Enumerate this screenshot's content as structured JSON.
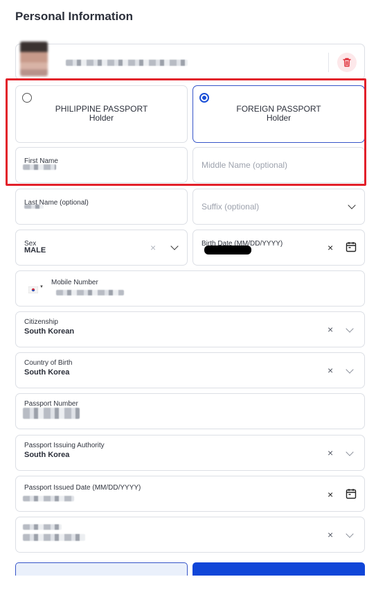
{
  "page": {
    "title": "Personal Information"
  },
  "passport_type": {
    "options": [
      {
        "line1": "PHILIPPINE PASSPORT",
        "line2": "Holder",
        "selected": false
      },
      {
        "line1": "FOREIGN PASSPORT",
        "line2": "Holder",
        "selected": true
      }
    ]
  },
  "fields": {
    "first_name": {
      "label": "First Name"
    },
    "middle_name": {
      "placeholder": "Middle Name (optional)"
    },
    "last_name": {
      "label": "Last Name (optional)"
    },
    "suffix": {
      "placeholder": "Suffix (optional)"
    },
    "sex": {
      "label": "Sex",
      "value": "MALE"
    },
    "birth_date": {
      "label": "Birth Date (MM/DD/YYYY)"
    },
    "mobile": {
      "label": "Mobile Number"
    },
    "citizenship": {
      "label": "Citizenship",
      "value": "South Korean"
    },
    "country_of_birth": {
      "label": "Country of Birth",
      "value": "South Korea"
    },
    "passport_number": {
      "label": "Passport Number"
    },
    "passport_authority": {
      "label": "Passport Issuing Authority",
      "value": "South Korea"
    },
    "passport_issued": {
      "label": "Passport Issued Date (MM/DD/YYYY)"
    }
  },
  "icons": {
    "clear": "×",
    "delete": "trash-icon",
    "calendar": "calendar-icon",
    "flag": "south-korea-flag-icon"
  },
  "colors": {
    "highlight": "#e2202a",
    "primary": "#1046d8",
    "selected_border": "#3554c8",
    "delete": "#e0303a"
  }
}
